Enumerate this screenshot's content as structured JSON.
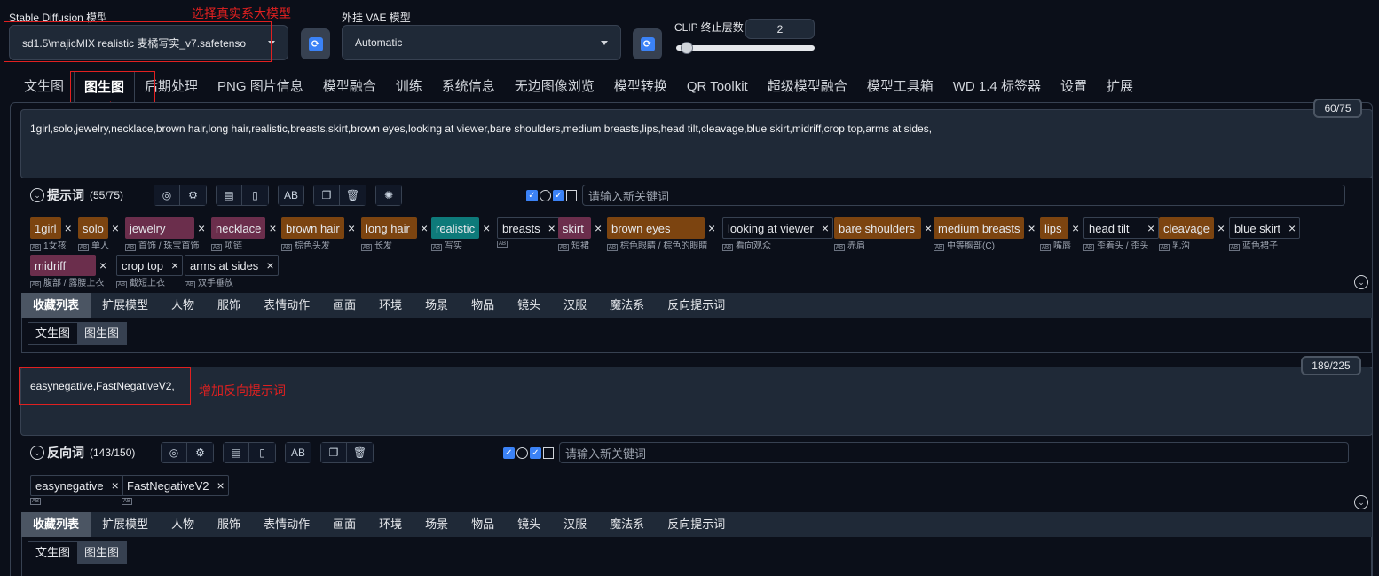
{
  "header": {
    "sd_model_label": "Stable Diffusion 模型",
    "sd_model_value": "sd1.5\\majicMIX realistic 麦橘写实_v7.safetenso",
    "annotation_model": "选择真实系大模型",
    "vae_label": "外挂 VAE 模型",
    "vae_value": "Automatic",
    "clip_label": "CLIP 终止层数",
    "clip_value": "2",
    "clip_slider_fraction": 0.08
  },
  "tabs": [
    "文生图",
    "图生图",
    "后期处理",
    "PNG 图片信息",
    "模型融合",
    "训练",
    "系统信息",
    "无边图像浏览",
    "模型转换",
    "QR Toolkit",
    "超级模型融合",
    "模型工具箱",
    "WD 1.4 标签器",
    "设置",
    "扩展"
  ],
  "prompt": {
    "text": "1girl,solo,jewelry,necklace,brown hair,long hair,realistic,breasts,skirt,brown eyes,looking at viewer,bare shoulders,medium breasts,lips,head tilt,cleavage,blue skirt,midriff,crop top,arms at sides,",
    "counter": "60/75",
    "toolbar_label": "提示词",
    "toolbar_count": "(55/75)",
    "kw_placeholder": "请输入新关键词",
    "tags": [
      {
        "value": "1girl",
        "sub": "1女孩",
        "color": "orange"
      },
      {
        "value": "solo",
        "sub": "单人",
        "color": "orange"
      },
      {
        "value": "jewelry",
        "sub": "首饰 / 珠宝首饰",
        "color": "pink"
      },
      {
        "value": "necklace",
        "sub": "项链",
        "color": "pink"
      },
      {
        "value": "brown hair",
        "sub": "棕色头发",
        "color": "orange"
      },
      {
        "value": "long hair",
        "sub": "长发",
        "color": "orange"
      },
      {
        "value": "realistic",
        "sub": "写实",
        "color": "teal"
      },
      {
        "value": "breasts",
        "sub": "",
        "color": "gray"
      },
      {
        "value": "skirt",
        "sub": "短裙",
        "color": "pink"
      },
      {
        "value": "brown eyes",
        "sub": "棕色眼睛 / 棕色的眼睛",
        "color": "orange"
      },
      {
        "value": "looking at viewer",
        "sub": "看向观众",
        "color": "gray"
      },
      {
        "value": "bare shoulders",
        "sub": "赤肩",
        "color": "orange"
      },
      {
        "value": "medium breasts",
        "sub": "中等胸部(C)",
        "color": "orange"
      },
      {
        "value": "lips",
        "sub": "嘴唇",
        "color": "orange"
      },
      {
        "value": "head tilt",
        "sub": "歪着头 / 歪头",
        "color": "gray"
      },
      {
        "value": "cleavage",
        "sub": "乳沟",
        "color": "orange"
      },
      {
        "value": "blue skirt",
        "sub": "蓝色裙子",
        "color": "gray"
      },
      {
        "value": "midriff",
        "sub": "腹部 / 露腰上衣",
        "color": "pink"
      },
      {
        "value": "crop top",
        "sub": "截短上衣",
        "color": "gray"
      },
      {
        "value": "arms at sides",
        "sub": "双手垂放",
        "color": "gray"
      }
    ]
  },
  "categories": [
    "收藏列表",
    "扩展模型",
    "人物",
    "服饰",
    "表情动作",
    "画面",
    "环境",
    "场景",
    "物品",
    "镜头",
    "汉服",
    "魔法系",
    "反向提示词"
  ],
  "subtabs": [
    "文生图",
    "图生图"
  ],
  "negative": {
    "text": "easynegative,FastNegativeV2,",
    "counter": "189/225",
    "annotation": "增加反向提示词",
    "toolbar_label": "反向词",
    "toolbar_count": "(143/150)",
    "kw_placeholder": "请输入新关键词",
    "tags": [
      {
        "value": "easynegative",
        "sub": ""
      },
      {
        "value": "FastNegativeV2",
        "sub": ""
      }
    ]
  },
  "colors": {
    "orange": "#7c4410",
    "pink": "#6b2e4c",
    "teal": "#0e7a7a",
    "annotation": "#e02020"
  }
}
